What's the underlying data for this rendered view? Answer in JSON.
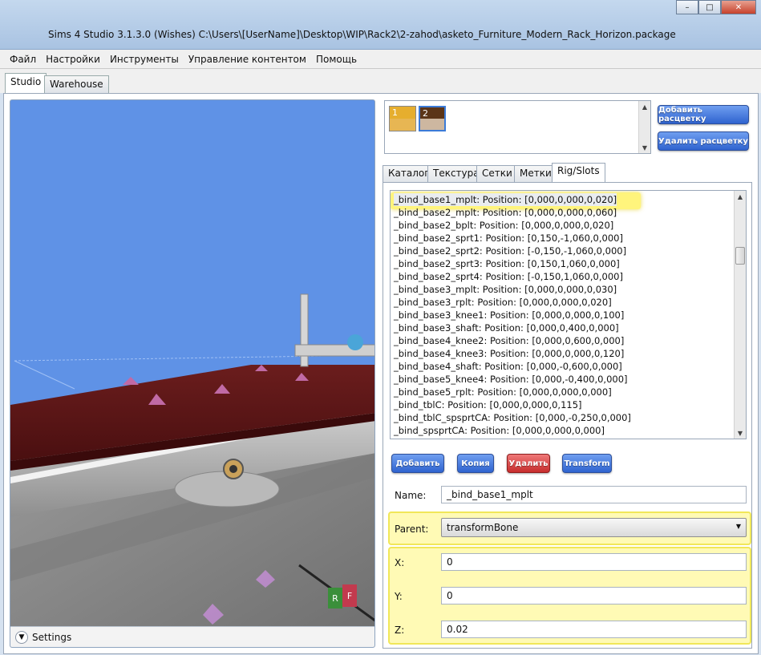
{
  "window": {
    "title": "Sims 4 Studio 3.1.3.0 (Wishes)  C:\\Users\\[UserName]\\Desktop\\WIP\\Rack2\\2-zahod\\asketo_Furniture_Modern_Rack_Horizon.package",
    "min_label": "–",
    "max_label": "□",
    "close_label": "✕"
  },
  "menu": [
    "Файл",
    "Настройки",
    "Инструменты",
    "Управление контентом",
    "Помощь"
  ],
  "main_tabs": [
    "Studio",
    "Warehouse"
  ],
  "viewport": {
    "settings_label": "Settings",
    "gizmo_r": "R",
    "gizmo_f": "F"
  },
  "swatches": [
    {
      "label": "1",
      "color_top": "#e6ae2e",
      "color_bottom": "#e7b653"
    },
    {
      "label": "2",
      "color_top": "#5b3518",
      "color_bottom": "#cdb7a0"
    }
  ],
  "swatch_buttons": {
    "add": "Добавить расцветку",
    "remove": "Удалить расцветку"
  },
  "sub_tabs": [
    "Каталог",
    "Текстура",
    "Сетки",
    "Метки",
    "Rig/Slots"
  ],
  "slots": [
    "_bind_base1_mplt: Position: [0,000,0,000,0,020]",
    "_bind_base2_mplt: Position: [0,000,0,000,0,060]",
    "_bind_base2_bplt: Position: [0,000,0,000,0,020]",
    "_bind_base2_sprt1: Position: [0,150,-1,060,0,000]",
    "_bind_base2_sprt2: Position: [-0,150,-1,060,0,000]",
    "_bind_base2_sprt3: Position: [0,150,1,060,0,000]",
    "_bind_base2_sprt4: Position: [-0,150,1,060,0,000]",
    "_bind_base3_mplt: Position: [0,000,0,000,0,030]",
    "_bind_base3_rplt: Position: [0,000,0,000,0,020]",
    "_bind_base3_knee1: Position: [0,000,0,000,0,100]",
    "_bind_base3_shaft: Position: [0,000,0,400,0,000]",
    "_bind_base4_knee2: Position: [0,000,0,600,0,000]",
    "_bind_base4_knee3: Position: [0,000,0,000,0,120]",
    "_bind_base4_shaft: Position: [0,000,-0,600,0,000]",
    "_bind_base5_knee4: Position: [0,000,-0,400,0,000]",
    "_bind_base5_rplt: Position: [0,000,0,000,0,000]",
    "_bind_tblC: Position: [0,000,0,000,0,115]",
    "_bind_tblC_spsprtCA: Position: [0,000,-0,250,0,000]",
    "_bind_spsprtCA: Position: [0,000,0,000,0,000]"
  ],
  "slot_buttons": {
    "add": "Добавить",
    "copy": "Копия",
    "delete": "Удалить",
    "transform": "Transform"
  },
  "form": {
    "name_label": "Name:",
    "name_value": "_bind_base1_mplt",
    "parent_label": "Parent:",
    "parent_value": "transformBone",
    "x_label": "X:",
    "x_value": "0",
    "y_label": "Y:",
    "y_value": "0",
    "z_label": "Z:",
    "z_value": "0.02"
  },
  "colors": {
    "viewport_bg": "#5f92e6",
    "highlight": "#fff050",
    "button_blue": "#2f63cf",
    "button_red": "#c72c2c"
  }
}
